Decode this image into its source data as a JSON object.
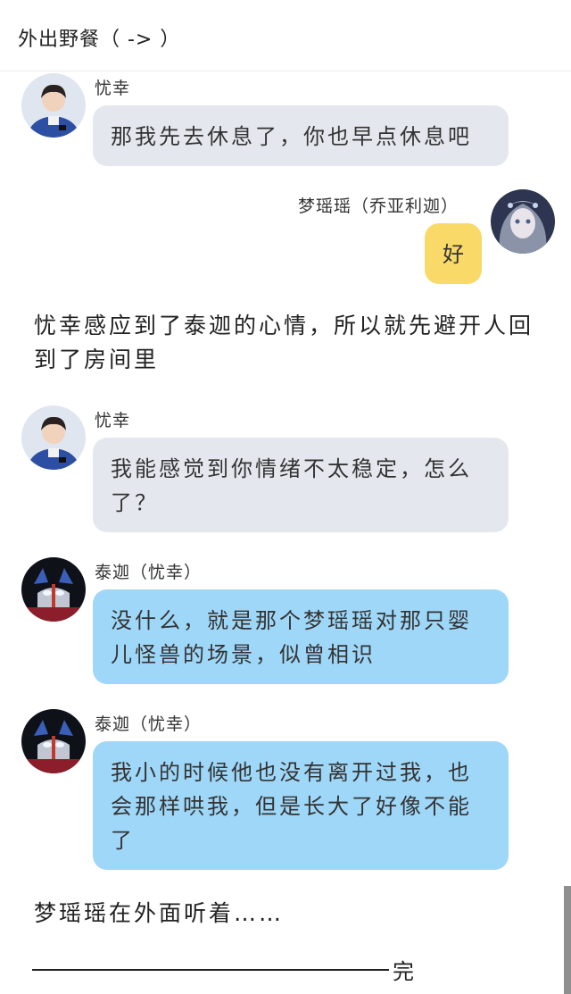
{
  "header": {
    "title": "外出野餐（ -> ）"
  },
  "messages": [
    {
      "sender": "忧幸",
      "text": "那我先去休息了，你也早点休息吧"
    },
    {
      "sender": "梦瑶瑶（乔亚利迦）",
      "text": "好"
    },
    {
      "narration": "忧幸感应到了泰迦的心情，所以就先避开人回到了房间里"
    },
    {
      "sender": "忧幸",
      "text": "我能感觉到你情绪不太稳定，怎么了？"
    },
    {
      "sender": "泰迦（忧幸）",
      "text": "没什么，就是那个梦瑶瑶对那只婴儿怪兽的场景，似曾相识"
    },
    {
      "sender": "泰迦（忧幸）",
      "text": "我小的时候他也没有离开过我，也会那样哄我，但是长大了好像不能了"
    },
    {
      "narration": "梦瑶瑶在外面听着……"
    }
  ],
  "end_mark": "完",
  "colors": {
    "gray_bubble": "#e4e8ee",
    "blue_bubble": "#9fd7f8",
    "yellow_bubble": "#f9da68"
  },
  "avatars": {
    "youxing": "person-in-blue-uniform",
    "mengyaoyao": "fantasy-girl-portrait",
    "taiga": "ultraman-taiga-portrait"
  }
}
